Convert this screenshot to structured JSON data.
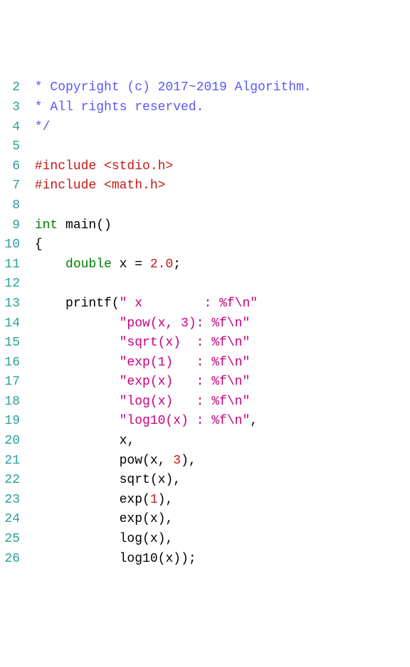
{
  "lines": [
    {
      "n": "2",
      "tokens": [
        {
          "cls": "c-comment",
          "t": " * Copyright (c) 2017~2019 Algorithm."
        }
      ]
    },
    {
      "n": "3",
      "tokens": [
        {
          "cls": "c-comment",
          "t": " * All rights reserved."
        }
      ]
    },
    {
      "n": "4",
      "tokens": [
        {
          "cls": "c-comment",
          "t": " */"
        }
      ]
    },
    {
      "n": "5",
      "tokens": []
    },
    {
      "n": "6",
      "tokens": [
        {
          "cls": "c-preproc",
          "t": " #include "
        },
        {
          "cls": "c-include",
          "t": "<stdio.h>"
        }
      ]
    },
    {
      "n": "7",
      "tokens": [
        {
          "cls": "c-preproc",
          "t": " #include "
        },
        {
          "cls": "c-include",
          "t": "<math.h>"
        }
      ]
    },
    {
      "n": "8",
      "tokens": []
    },
    {
      "n": "9",
      "tokens": [
        {
          "cls": "c-plain",
          "t": " "
        },
        {
          "cls": "c-type",
          "t": "int"
        },
        {
          "cls": "c-plain",
          "t": " "
        },
        {
          "cls": "c-id",
          "t": "main"
        },
        {
          "cls": "c-punct",
          "t": "()"
        }
      ]
    },
    {
      "n": "10",
      "tokens": [
        {
          "cls": "c-punct",
          "t": " {"
        }
      ]
    },
    {
      "n": "11",
      "tokens": [
        {
          "cls": "c-plain",
          "t": "     "
        },
        {
          "cls": "c-type",
          "t": "double"
        },
        {
          "cls": "c-plain",
          "t": " "
        },
        {
          "cls": "c-id",
          "t": "x"
        },
        {
          "cls": "c-plain",
          "t": " = "
        },
        {
          "cls": "c-num",
          "t": "2.0"
        },
        {
          "cls": "c-punct",
          "t": ";"
        }
      ]
    },
    {
      "n": "12",
      "tokens": []
    },
    {
      "n": "13",
      "tokens": [
        {
          "cls": "c-plain",
          "t": "     "
        },
        {
          "cls": "c-id",
          "t": "printf"
        },
        {
          "cls": "c-punct",
          "t": "("
        },
        {
          "cls": "c-str",
          "t": "\" x        : %f\\n\""
        }
      ]
    },
    {
      "n": "14",
      "tokens": [
        {
          "cls": "c-plain",
          "t": "            "
        },
        {
          "cls": "c-str",
          "t": "\"pow(x, 3): %f\\n\""
        }
      ]
    },
    {
      "n": "15",
      "tokens": [
        {
          "cls": "c-plain",
          "t": "            "
        },
        {
          "cls": "c-str",
          "t": "\"sqrt(x)  : %f\\n\""
        }
      ]
    },
    {
      "n": "16",
      "tokens": [
        {
          "cls": "c-plain",
          "t": "            "
        },
        {
          "cls": "c-str",
          "t": "\"exp(1)   : %f\\n\""
        }
      ]
    },
    {
      "n": "17",
      "tokens": [
        {
          "cls": "c-plain",
          "t": "            "
        },
        {
          "cls": "c-str",
          "t": "\"exp(x)   : %f\\n\""
        }
      ]
    },
    {
      "n": "18",
      "tokens": [
        {
          "cls": "c-plain",
          "t": "            "
        },
        {
          "cls": "c-str",
          "t": "\"log(x)   : %f\\n\""
        }
      ]
    },
    {
      "n": "19",
      "tokens": [
        {
          "cls": "c-plain",
          "t": "            "
        },
        {
          "cls": "c-str",
          "t": "\"log10(x) : %f\\n\""
        },
        {
          "cls": "c-punct",
          "t": ","
        }
      ]
    },
    {
      "n": "20",
      "tokens": [
        {
          "cls": "c-plain",
          "t": "            "
        },
        {
          "cls": "c-id",
          "t": "x"
        },
        {
          "cls": "c-punct",
          "t": ","
        }
      ]
    },
    {
      "n": "21",
      "tokens": [
        {
          "cls": "c-plain",
          "t": "            "
        },
        {
          "cls": "c-id",
          "t": "pow"
        },
        {
          "cls": "c-punct",
          "t": "("
        },
        {
          "cls": "c-id",
          "t": "x"
        },
        {
          "cls": "c-punct",
          "t": ", "
        },
        {
          "cls": "c-num",
          "t": "3"
        },
        {
          "cls": "c-punct",
          "t": "),"
        }
      ]
    },
    {
      "n": "22",
      "tokens": [
        {
          "cls": "c-plain",
          "t": "            "
        },
        {
          "cls": "c-id",
          "t": "sqrt"
        },
        {
          "cls": "c-punct",
          "t": "("
        },
        {
          "cls": "c-id",
          "t": "x"
        },
        {
          "cls": "c-punct",
          "t": "),"
        }
      ]
    },
    {
      "n": "23",
      "tokens": [
        {
          "cls": "c-plain",
          "t": "            "
        },
        {
          "cls": "c-id",
          "t": "exp"
        },
        {
          "cls": "c-punct",
          "t": "("
        },
        {
          "cls": "c-num",
          "t": "1"
        },
        {
          "cls": "c-punct",
          "t": "),"
        }
      ]
    },
    {
      "n": "24",
      "tokens": [
        {
          "cls": "c-plain",
          "t": "            "
        },
        {
          "cls": "c-id",
          "t": "exp"
        },
        {
          "cls": "c-punct",
          "t": "("
        },
        {
          "cls": "c-id",
          "t": "x"
        },
        {
          "cls": "c-punct",
          "t": "),"
        }
      ]
    },
    {
      "n": "25",
      "tokens": [
        {
          "cls": "c-plain",
          "t": "            "
        },
        {
          "cls": "c-id",
          "t": "log"
        },
        {
          "cls": "c-punct",
          "t": "("
        },
        {
          "cls": "c-id",
          "t": "x"
        },
        {
          "cls": "c-punct",
          "t": "),"
        }
      ]
    },
    {
      "n": "26",
      "tokens": [
        {
          "cls": "c-plain",
          "t": "            "
        },
        {
          "cls": "c-id",
          "t": "log10"
        },
        {
          "cls": "c-punct",
          "t": "("
        },
        {
          "cls": "c-id",
          "t": "x"
        },
        {
          "cls": "c-punct",
          "t": "));"
        }
      ]
    }
  ]
}
